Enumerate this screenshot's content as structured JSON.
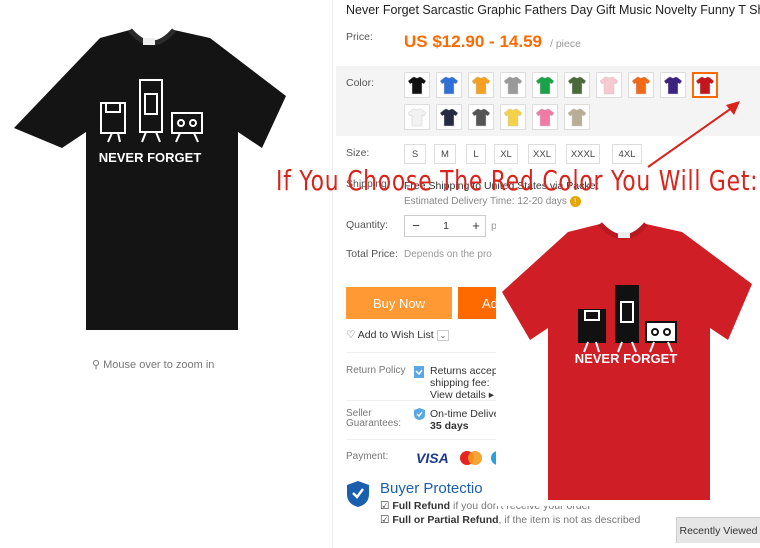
{
  "product": {
    "title": "Never Forget Sarcastic Graphic Fathers Day Gift Music Novelty Funny T Shirt",
    "price_label": "Price:",
    "price": "US $12.90 - 14.59",
    "price_unit": "/ piece"
  },
  "left": {
    "shirt_print_text": "NEVER FORGET",
    "zoom_hint": "Mouse over to zoom in"
  },
  "color": {
    "label": "Color:",
    "swatches": [
      "#111111",
      "#2f6fd6",
      "#f5a020",
      "#999999",
      "#1aa24a",
      "#4a6a3a",
      "#f6c8d2",
      "#f06a1a",
      "#3a2480",
      "#c4161c",
      "#f2f2f2",
      "#252b40",
      "#555555",
      "#f3d24a",
      "#f07aa6",
      "#b8ad95"
    ],
    "selected_index": 9
  },
  "size": {
    "label": "Size:",
    "options": [
      "S",
      "M",
      "L",
      "XL",
      "XXL",
      "XXXL",
      "4XL"
    ]
  },
  "overlay_caption": "If You Choose The Red Color You Will Get:",
  "shipping": {
    "label": "Shipping:",
    "text": "Free Shipping to United States via Packet",
    "estimate": "Estimated Delivery Time: 12-20 days"
  },
  "quantity": {
    "label": "Quantity:",
    "value": "1",
    "minus": "−",
    "plus": "+",
    "trailing": "p"
  },
  "total": {
    "label": "Total Price:",
    "text": "Depends on the pro"
  },
  "actions": {
    "buy_now": "Buy Now",
    "add_to_cart": "Ad",
    "wishlist": "Add to Wish List"
  },
  "return_policy": {
    "label": "Return Policy",
    "line1": "Returns accep",
    "line2": "shipping fee: ",
    "link": "View details"
  },
  "guarantees": {
    "label1": "Seller",
    "label2": "Guarantees:",
    "line1": "On-time Delive",
    "line2": "35 days"
  },
  "payment": {
    "label": "Payment:",
    "visa": "VISA"
  },
  "buyer_protection": {
    "title": "Buyer Protectio",
    "full_refund": "Full Refund",
    "full_refund_text": "if you don't receive your order",
    "partial_refund": "Full or Partial Refund",
    "partial_refund_text": ", if the item is not as described"
  },
  "red_shirt": {
    "print_text": "NEVER FORGET",
    "color": "#d01e26"
  },
  "recently_viewed": "Recently Viewed"
}
